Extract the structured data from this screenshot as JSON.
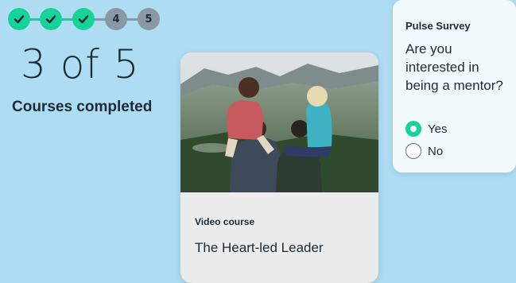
{
  "progress": {
    "steps": [
      {
        "label": "",
        "status": "done"
      },
      {
        "label": "",
        "status": "done"
      },
      {
        "label": "",
        "status": "done"
      },
      {
        "label": "4",
        "status": "todo"
      },
      {
        "label": "5",
        "status": "todo"
      }
    ],
    "summary": "3 of 5",
    "caption": "Courses completed"
  },
  "video_card": {
    "type_label": "Video course",
    "title": "The Heart-led Leader"
  },
  "survey": {
    "heading": "Pulse Survey",
    "question": "Are you interested in being a mentor?",
    "options": [
      {
        "label": "Yes",
        "selected": true
      },
      {
        "label": "No",
        "selected": false
      }
    ]
  },
  "colors": {
    "background": "#aedcf2",
    "accent_green": "#16d39a",
    "pending_gray": "#8a98a4"
  },
  "icons": {
    "step_done": "checkmark-icon"
  }
}
